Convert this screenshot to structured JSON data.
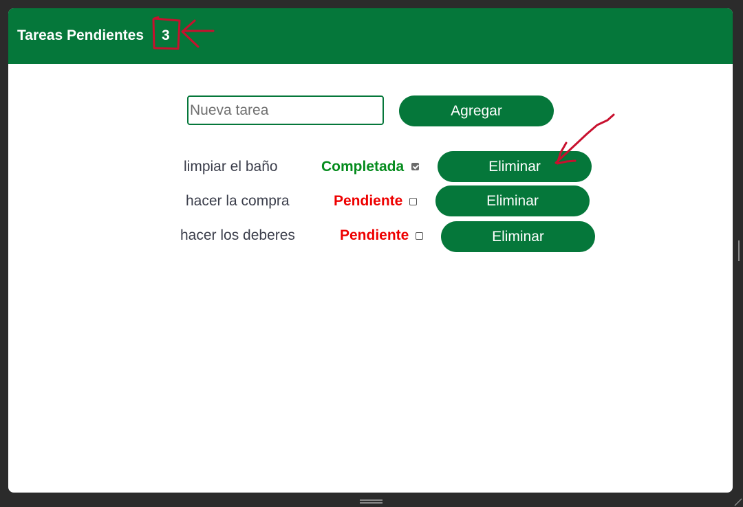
{
  "header": {
    "title": "Tareas Pendientes",
    "count": "3"
  },
  "form": {
    "placeholder": "Nueva tarea",
    "value": "",
    "add_label": "Agregar"
  },
  "tasks": [
    {
      "text": "limpiar el baño",
      "status": "Completada",
      "completed": true,
      "delete_label": "Eliminar"
    },
    {
      "text": "hacer la compra",
      "status": "Pendiente",
      "completed": false,
      "delete_label": "Eliminar"
    },
    {
      "text": "hacer los deberes",
      "status": "Pendiente",
      "completed": false,
      "delete_label": "Eliminar"
    }
  ],
  "colors": {
    "brand_green": "#05773a",
    "completed_text": "#068c1e",
    "pending_text": "#ee0000",
    "annotation_red": "#c8102e"
  }
}
